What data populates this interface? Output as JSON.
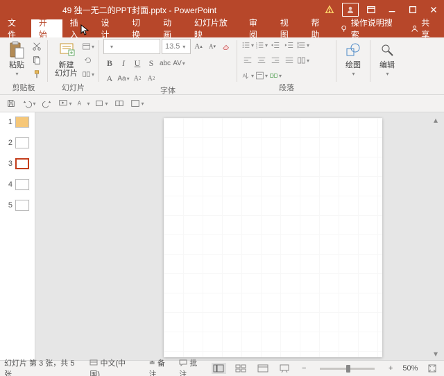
{
  "title": "49 独一无二的PPT封面.pptx - PowerPoint",
  "tabs": {
    "file": "文件",
    "home": "开始",
    "insert": "插入",
    "design": "设计",
    "transitions": "切换",
    "animations": "动画",
    "slideshow": "幻灯片放映",
    "review": "审阅",
    "view": "视图",
    "help": "帮助",
    "active": "home",
    "tellme": "操作说明搜索",
    "share": "共享"
  },
  "ribbon": {
    "clipboard": {
      "label": "剪贴板",
      "paste": "粘贴"
    },
    "slides": {
      "label": "幻灯片",
      "newSlide": "新建\n幻灯片"
    },
    "font": {
      "label": "字体",
      "fontname": "",
      "size": "13.5"
    },
    "paragraph": {
      "label": "段落"
    },
    "drawing": {
      "label": "绘图",
      "btn": "绘图"
    },
    "editing": {
      "label": "编辑",
      "btn": "编辑"
    }
  },
  "thumbs": {
    "count": 5,
    "selected": 3
  },
  "status": {
    "slide": "幻灯片 第 3 张，共 5 张",
    "lang": "中文(中国)",
    "notes": "备注",
    "comments": "批注",
    "zoom": "50%"
  }
}
